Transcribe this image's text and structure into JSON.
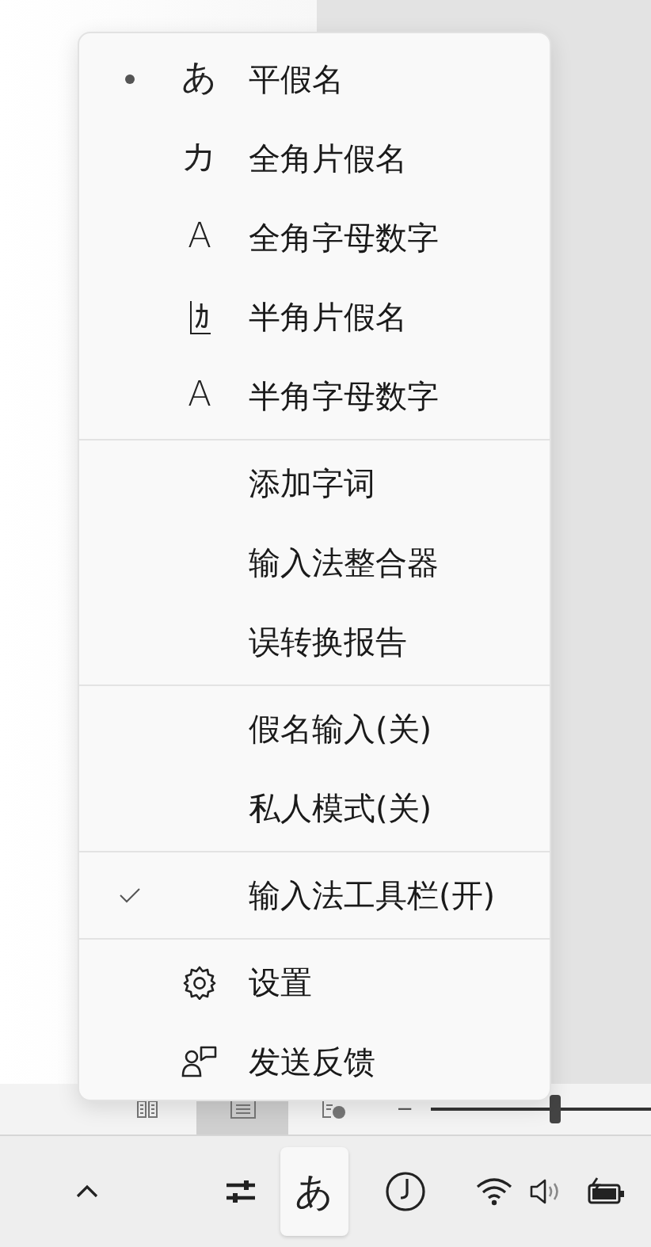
{
  "menu": {
    "sections": [
      {
        "items": [
          {
            "kind": "radio",
            "glyph": "あ",
            "label": "平假名",
            "selected": true
          },
          {
            "kind": "radio",
            "glyph": "カ",
            "label": "全角片假名",
            "selected": false
          },
          {
            "kind": "radio",
            "glyph": "A",
            "label": "全角字母数字",
            "selected": false
          },
          {
            "kind": "radio",
            "glyph": "ｶ",
            "label": "半角片假名",
            "selected": false
          },
          {
            "kind": "radio",
            "glyph": "A",
            "label": "半角字母数字",
            "selected": false
          }
        ]
      },
      {
        "items": [
          {
            "kind": "plain",
            "label": "添加字词"
          },
          {
            "kind": "plain",
            "label": "输入法整合器"
          },
          {
            "kind": "plain",
            "label": "误转换报告"
          }
        ]
      },
      {
        "items": [
          {
            "kind": "plain",
            "label": "假名输入(关)"
          },
          {
            "kind": "plain",
            "label": "私人模式(关)"
          }
        ]
      },
      {
        "items": [
          {
            "kind": "check",
            "label": "输入法工具栏(开)",
            "checked": true
          }
        ]
      },
      {
        "items": [
          {
            "kind": "settings",
            "label": "设置"
          },
          {
            "kind": "feedback",
            "label": "发送反馈"
          }
        ]
      }
    ]
  },
  "status_bar": {
    "views": [
      {
        "kind": "book",
        "selected": false
      },
      {
        "kind": "page",
        "selected": true
      },
      {
        "kind": "web",
        "selected": false
      }
    ],
    "zoom_out": "−",
    "zoom": {
      "level": 0.56
    }
  },
  "taskbar": {
    "ime_button": "あ"
  }
}
